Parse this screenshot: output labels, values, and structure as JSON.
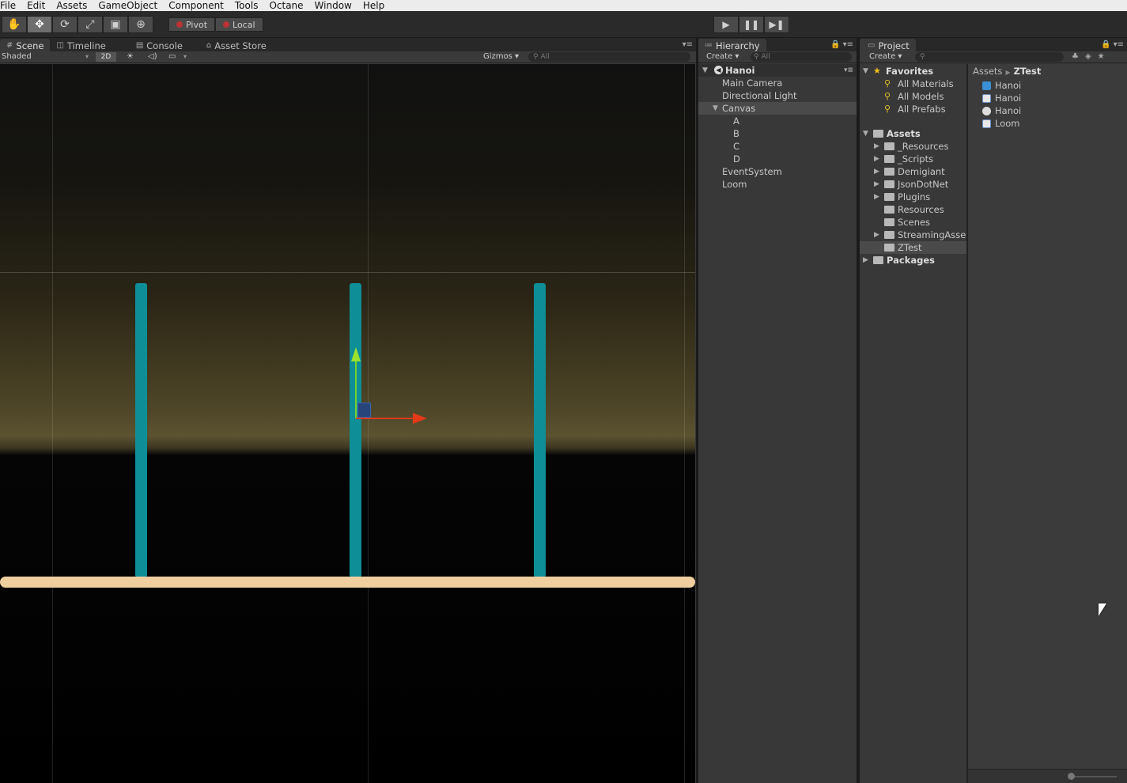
{
  "menu": [
    "File",
    "Edit",
    "Assets",
    "GameObject",
    "Component",
    "Tools",
    "Octane",
    "Window",
    "Help"
  ],
  "toolbar": {
    "tools": [
      {
        "name": "hand-tool",
        "glyph": "✋"
      },
      {
        "name": "move-tool",
        "glyph": "✥"
      },
      {
        "name": "rotate-tool",
        "glyph": "⟳"
      },
      {
        "name": "scale-tool",
        "glyph": "⤢"
      },
      {
        "name": "rect-tool",
        "glyph": "▣"
      },
      {
        "name": "transform-tool",
        "glyph": "⊕"
      }
    ],
    "active_tool": "move-tool",
    "pivot_label": "Pivot",
    "local_label": "Local",
    "play_glyph": "▶",
    "pause_glyph": "❚❚",
    "step_glyph": "▶❚"
  },
  "scene": {
    "tabs": [
      {
        "label": "Scene",
        "icon": "grid-icon",
        "glyph": "#"
      },
      {
        "label": "Timeline",
        "icon": "timeline-icon",
        "glyph": "◫"
      },
      {
        "label": "Console",
        "icon": "console-icon",
        "glyph": "▤"
      },
      {
        "label": "Asset Store",
        "icon": "asset-store-icon",
        "glyph": "⌂"
      }
    ],
    "shading_mode": "Shaded",
    "mode_2d": "2D",
    "gizmos_label": "Gizmos",
    "search_placeholder": "All"
  },
  "hierarchy": {
    "tab_label": "Hierarchy",
    "create_label": "Create",
    "search_placeholder": "All",
    "scene_name": "Hanoi",
    "items": [
      {
        "label": "Main Camera",
        "depth": 1
      },
      {
        "label": "Directional Light",
        "depth": 1
      },
      {
        "label": "Canvas",
        "depth": 1,
        "expanded": true,
        "selected": true
      },
      {
        "label": "A",
        "depth": 2
      },
      {
        "label": "B",
        "depth": 2
      },
      {
        "label": "C",
        "depth": 2
      },
      {
        "label": "D",
        "depth": 2
      },
      {
        "label": "EventSystem",
        "depth": 1
      },
      {
        "label": "Loom",
        "depth": 1
      }
    ]
  },
  "project": {
    "tab_label": "Project",
    "create_label": "Create",
    "favorites_label": "Favorites",
    "favorites": [
      "All Materials",
      "All Models",
      "All Prefabs"
    ],
    "assets_label": "Assets",
    "folders": [
      {
        "label": "_Resources",
        "has_children": true
      },
      {
        "label": "_Scripts",
        "has_children": true
      },
      {
        "label": "Demigiant",
        "has_children": true
      },
      {
        "label": "JsonDotNet",
        "has_children": true
      },
      {
        "label": "Plugins",
        "has_children": true
      },
      {
        "label": "Resources",
        "has_children": false
      },
      {
        "label": "Scenes",
        "has_children": false
      },
      {
        "label": "StreamingAsset",
        "has_children": true
      },
      {
        "label": "ZTest",
        "has_children": false,
        "selected": true
      }
    ],
    "packages_label": "Packages",
    "breadcrumb": [
      "Assets",
      "ZTest"
    ],
    "files": [
      {
        "label": "Hanoi",
        "type": "prefab",
        "color": "#3a8fd6"
      },
      {
        "label": "Hanoi",
        "type": "script",
        "color": "#6b8fc4"
      },
      {
        "label": "Hanoi",
        "type": "scene",
        "color": "#dddddd"
      },
      {
        "label": "Loom",
        "type": "script",
        "color": "#6b8fc4"
      }
    ]
  },
  "colors": {
    "pole": "#0e8e97",
    "base": "#efcf9f",
    "gizmo_y": "#7ad12c",
    "gizmo_x": "#d63a1e"
  }
}
